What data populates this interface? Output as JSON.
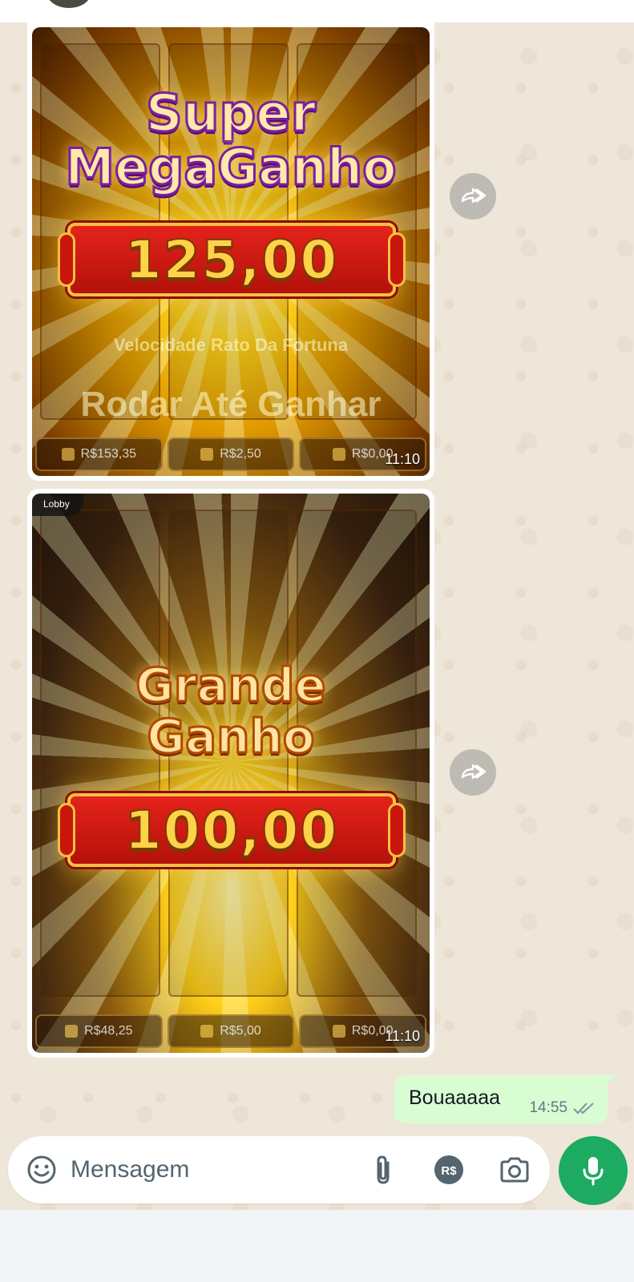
{
  "messages": {
    "image1": {
      "title_line1": "Super",
      "title_line2": "MegaGanho",
      "amount": "125,00",
      "faded_line1": "Velocidade Rato Da Fortuna",
      "faded_line2": "Rodar Até Ganhar",
      "stats": [
        "R$153,35",
        "R$2,50",
        "R$0,00"
      ],
      "time": "11:10"
    },
    "image2": {
      "badge": "Lobby",
      "title_line1": "Grande",
      "title_line2": "Ganho",
      "amount": "100,00",
      "stats": [
        "R$48,25",
        "R$5,00",
        "R$0,00"
      ],
      "time": "11:10"
    },
    "outgoing": {
      "text": "Bouaaaaa",
      "time": "14:55",
      "status": "read"
    }
  },
  "composer": {
    "placeholder": "Mensagem",
    "currency_label": "R$"
  },
  "icons": {
    "forward": "forward-icon",
    "emoji": "emoji-icon",
    "attach": "paperclip-icon",
    "payment": "payment-icon",
    "camera": "camera-icon",
    "mic": "microphone-icon",
    "read_receipt": "double-check-icon"
  },
  "colors": {
    "mic_button": "#1daa61",
    "outgoing_bubble": "#d9fdd3",
    "chat_background": "#efe6da"
  }
}
